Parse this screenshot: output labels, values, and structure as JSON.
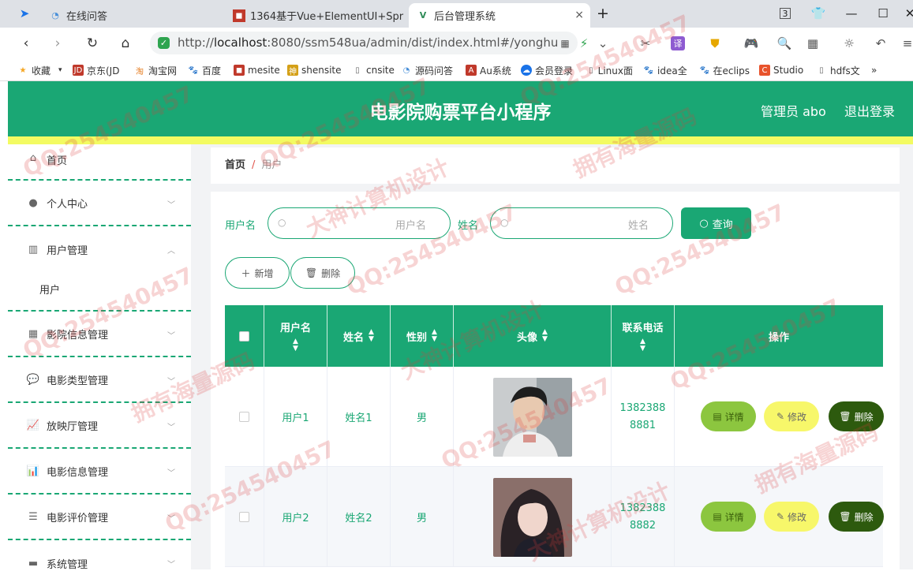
{
  "browser": {
    "tabs": [
      {
        "label": "在线问答"
      },
      {
        "label": "1364基于Vue+ElementUI+Spr"
      },
      {
        "label": "后台管理系统"
      }
    ],
    "tab_close": "×",
    "new_tab": "+",
    "url_prefix": "http://",
    "url_host": "localhost",
    "url_rest": ":8080/ssm548ua/admin/dist/index.html#/yonghu",
    "bookmarks": [
      "收藏",
      "京东(JD",
      "淘宝网",
      "百度",
      "mesite",
      "shensite",
      "cnsite",
      "源码问答",
      "Au系统",
      "会员登录",
      "Linux面",
      "idea全",
      "在eclips",
      "Studio",
      "hdfs文"
    ],
    "more": "»"
  },
  "header": {
    "title": "电影院购票平台小程序",
    "admin": "管理员 abo",
    "logout": "退出登录"
  },
  "sidebar": {
    "items": [
      {
        "label": "首页"
      },
      {
        "label": "个人中心"
      },
      {
        "label": "用户管理"
      },
      {
        "label": "用户"
      },
      {
        "label": "影院信息管理"
      },
      {
        "label": "电影类型管理"
      },
      {
        "label": "放映厅管理"
      },
      {
        "label": "电影信息管理"
      },
      {
        "label": "电影评价管理"
      },
      {
        "label": "系统管理"
      }
    ]
  },
  "breadcrumb": {
    "home": "首页",
    "sep": "/",
    "current": "用户"
  },
  "search": {
    "username_label": "用户名",
    "username_placeholder": "用户名",
    "name_label": "姓名",
    "name_placeholder": "姓名",
    "query_label": "查询"
  },
  "ops": {
    "add": "新增",
    "delete": "删除"
  },
  "table": {
    "headers": [
      "用户名",
      "姓名",
      "性别",
      "头像",
      "联系电话",
      "操作"
    ],
    "rows": [
      {
        "username": "用户1",
        "name": "姓名1",
        "gender": "男",
        "phone_a": "1382388",
        "phone_b": "8881"
      },
      {
        "username": "用户2",
        "name": "姓名2",
        "gender": "男",
        "phone_a": "1382388",
        "phone_b": "8882"
      }
    ],
    "actions": {
      "detail": "详情",
      "edit": "修改",
      "del": "删除"
    }
  },
  "watermarks": [
    "QQ:254540457",
    "拥有海量源码",
    "大神计算机设计"
  ],
  "colors": {
    "primary": "#1aa774",
    "accent_yellow": "#f3fb62",
    "detail_btn": "#8cc63f",
    "edit_btn": "#f7f76a",
    "delete_btn": "#2d5a0e"
  }
}
